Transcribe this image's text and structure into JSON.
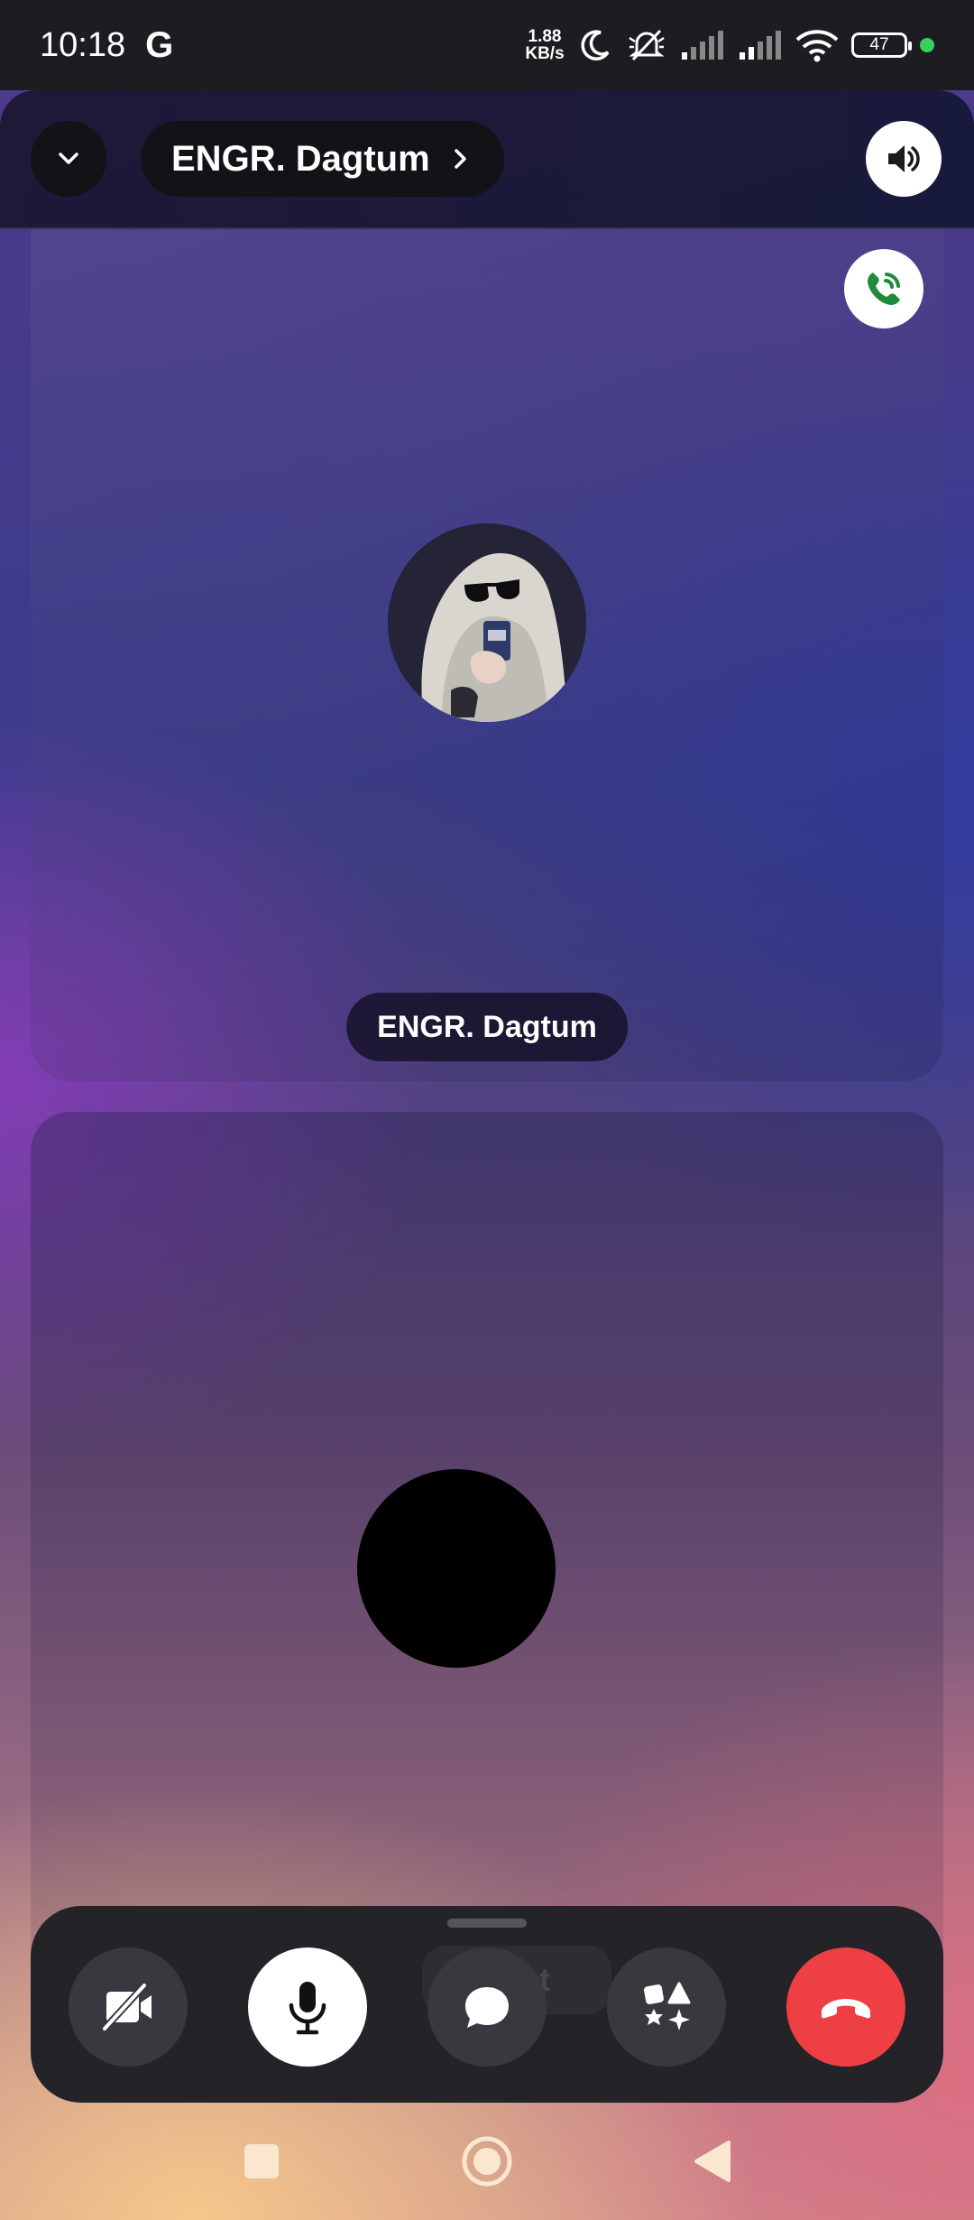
{
  "status_bar": {
    "time": "10:18",
    "google_icon": "G",
    "net_speed_value": "1.88",
    "net_speed_unit": "KB/s",
    "battery": "47",
    "icons": [
      "moon-icon",
      "bell-off-icon",
      "signal-icon",
      "signal-icon",
      "wifi-icon",
      "battery-icon"
    ],
    "active_dot_color": "#35d15a"
  },
  "header": {
    "title": "ENGR. Dagtum",
    "collapse_icon": "chevron-down-icon",
    "title_icon": "chevron-right-icon",
    "speaker_icon": "speaker-icon"
  },
  "participants": [
    {
      "name": "ENGR. Dagtum",
      "badge_icon": "phone-voice-icon",
      "avatar_icon": "avatar-ghost-sunglasses"
    },
    {
      "name": "",
      "avatar_icon": "avatar-black"
    }
  ],
  "controls": {
    "ghost_label": "chat",
    "buttons": [
      {
        "name": "camera-off",
        "icon": "camera-off-icon"
      },
      {
        "name": "microphone",
        "icon": "microphone-icon"
      },
      {
        "name": "chat",
        "icon": "chat-bubble-icon"
      },
      {
        "name": "activities",
        "icon": "shapes-icon"
      },
      {
        "name": "end-call",
        "icon": "phone-hangup-icon"
      }
    ],
    "colors": {
      "end_call": "#ee3f44",
      "mic_active": "#ffffff"
    }
  },
  "nav_bar": {
    "buttons": [
      "recents-icon",
      "home-icon",
      "back-icon"
    ]
  }
}
